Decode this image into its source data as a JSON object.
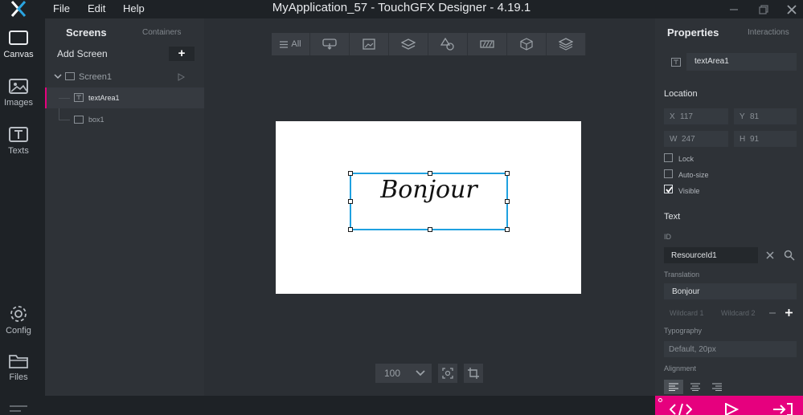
{
  "window": {
    "title": "MyApplication_57 - TouchGFX Designer - 4.19.1"
  },
  "menu": {
    "file": "File",
    "edit": "Edit",
    "help": "Help"
  },
  "nav": {
    "canvas": "Canvas",
    "images": "Images",
    "texts": "Texts",
    "config": "Config",
    "files": "Files"
  },
  "screens_panel": {
    "tab_screens": "Screens",
    "tab_containers": "Containers",
    "add_screen": "Add Screen",
    "add_symbol": "+",
    "tree": {
      "screen": "Screen1",
      "children": [
        "textArea1",
        "box1"
      ]
    }
  },
  "canvas": {
    "toolbar_all": "All",
    "zoom": "100",
    "text_content": "Bonjour"
  },
  "properties": {
    "title": "Properties",
    "interactions": "Interactions",
    "name": "textArea1",
    "location_title": "Location",
    "x_label": "X",
    "x_value": "117",
    "y_label": "Y",
    "y_value": "81",
    "w_label": "W",
    "w_value": "247",
    "h_label": "H",
    "h_value": "91",
    "lock": "Lock",
    "autosize": "Auto-size",
    "visible": "Visible",
    "lock_checked": false,
    "autosize_checked": false,
    "visible_checked": true,
    "text_title": "Text",
    "id_label": "ID",
    "id_value": "ResourceId1",
    "translation_label": "Translation",
    "translation_value": "Bonjour",
    "wildcard1": "Wildcard 1",
    "wildcard2": "Wildcard 2",
    "typography_label": "Typography",
    "typography_value": "Default, 20px",
    "alignment_label": "Alignment"
  },
  "colors": {
    "accent_pink": "#e6007e",
    "selection_blue": "#1fa1e0"
  }
}
